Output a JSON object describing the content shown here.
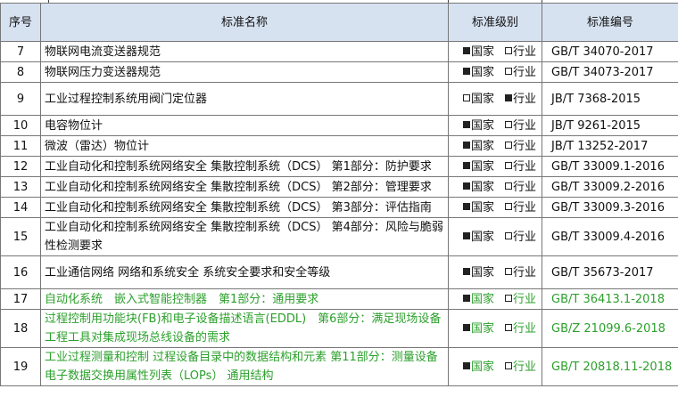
{
  "headers": {
    "seq": "序号",
    "name": "标准名称",
    "level": "标准级别",
    "code": "标准编号"
  },
  "level_labels": {
    "national": "国家",
    "industry": "行业"
  },
  "colors": {
    "header_bg": "#d7e2f1",
    "highlight_text": "#2ca02c",
    "border": "#777777"
  },
  "rows": [
    {
      "seq": "7",
      "name": "物联网电流变送器规范",
      "national": true,
      "industry": false,
      "code": "GB/T 34070-2017"
    },
    {
      "seq": "8",
      "name": "物联网压力变送器规范",
      "national": true,
      "industry": false,
      "code": "GB/T 34073-2017"
    },
    {
      "seq": "9",
      "name": "工业过程控制系统用阀门定位器",
      "national": false,
      "industry": true,
      "code": "JB/T 7368-2015"
    },
    {
      "seq": "10",
      "name": "电容物位计",
      "national": true,
      "industry": false,
      "code": "JB/T 9261-2015"
    },
    {
      "seq": "11",
      "name": "微波（雷达）物位计",
      "national": true,
      "industry": false,
      "code": "JB/T 13252-2017"
    },
    {
      "seq": "12",
      "name": "工业自动化和控制系统网络安全 集散控制系统（DCS） 第1部分：防护要求",
      "national": true,
      "industry": false,
      "code": "GB/T 33009.1-2016"
    },
    {
      "seq": "13",
      "name": "工业自动化和控制系统网络安全 集散控制系统（DCS） 第2部分：管理要求",
      "national": true,
      "industry": false,
      "code": "GB/T 33009.2-2016"
    },
    {
      "seq": "14",
      "name": "工业自动化和控制系统网络安全 集散控制系统（DCS） 第3部分：评估指南",
      "national": true,
      "industry": false,
      "code": "GB/T 33009.3-2016"
    },
    {
      "seq": "15",
      "name": "工业自动化和控制系统网络安全 集散控制系统（DCS） 第4部分：风险与脆弱性检测要求",
      "national": true,
      "industry": false,
      "code": "GB/T 33009.4-2016"
    },
    {
      "seq": "16",
      "name": "工业通信网络 网络和系统安全 系统安全要求和安全等级",
      "national": true,
      "industry": false,
      "code": "GB/T 35673-2017"
    },
    {
      "seq": "17",
      "name": "自动化系统　嵌入式智能控制器　第1部分：通用要求",
      "national": true,
      "industry": false,
      "code": "GB/T 36413.1-2018",
      "highlight": true
    },
    {
      "seq": "18",
      "name": "过程控制用功能块(FB)和电子设备描述语言(EDDL)　第6部分：满足现场设备工程工具对集成现场总线设备的需求",
      "national": true,
      "industry": false,
      "code": "GB/Z 21099.6-2018",
      "highlight": true
    },
    {
      "seq": "19",
      "name": "工业过程测量和控制 过程设备目录中的数据结构和元素 第11部分：测量设备电子数据交换用属性列表（LOPs） 通用结构",
      "national": true,
      "industry": false,
      "code": "GB/T 20818.11-2018",
      "highlight": true
    }
  ]
}
